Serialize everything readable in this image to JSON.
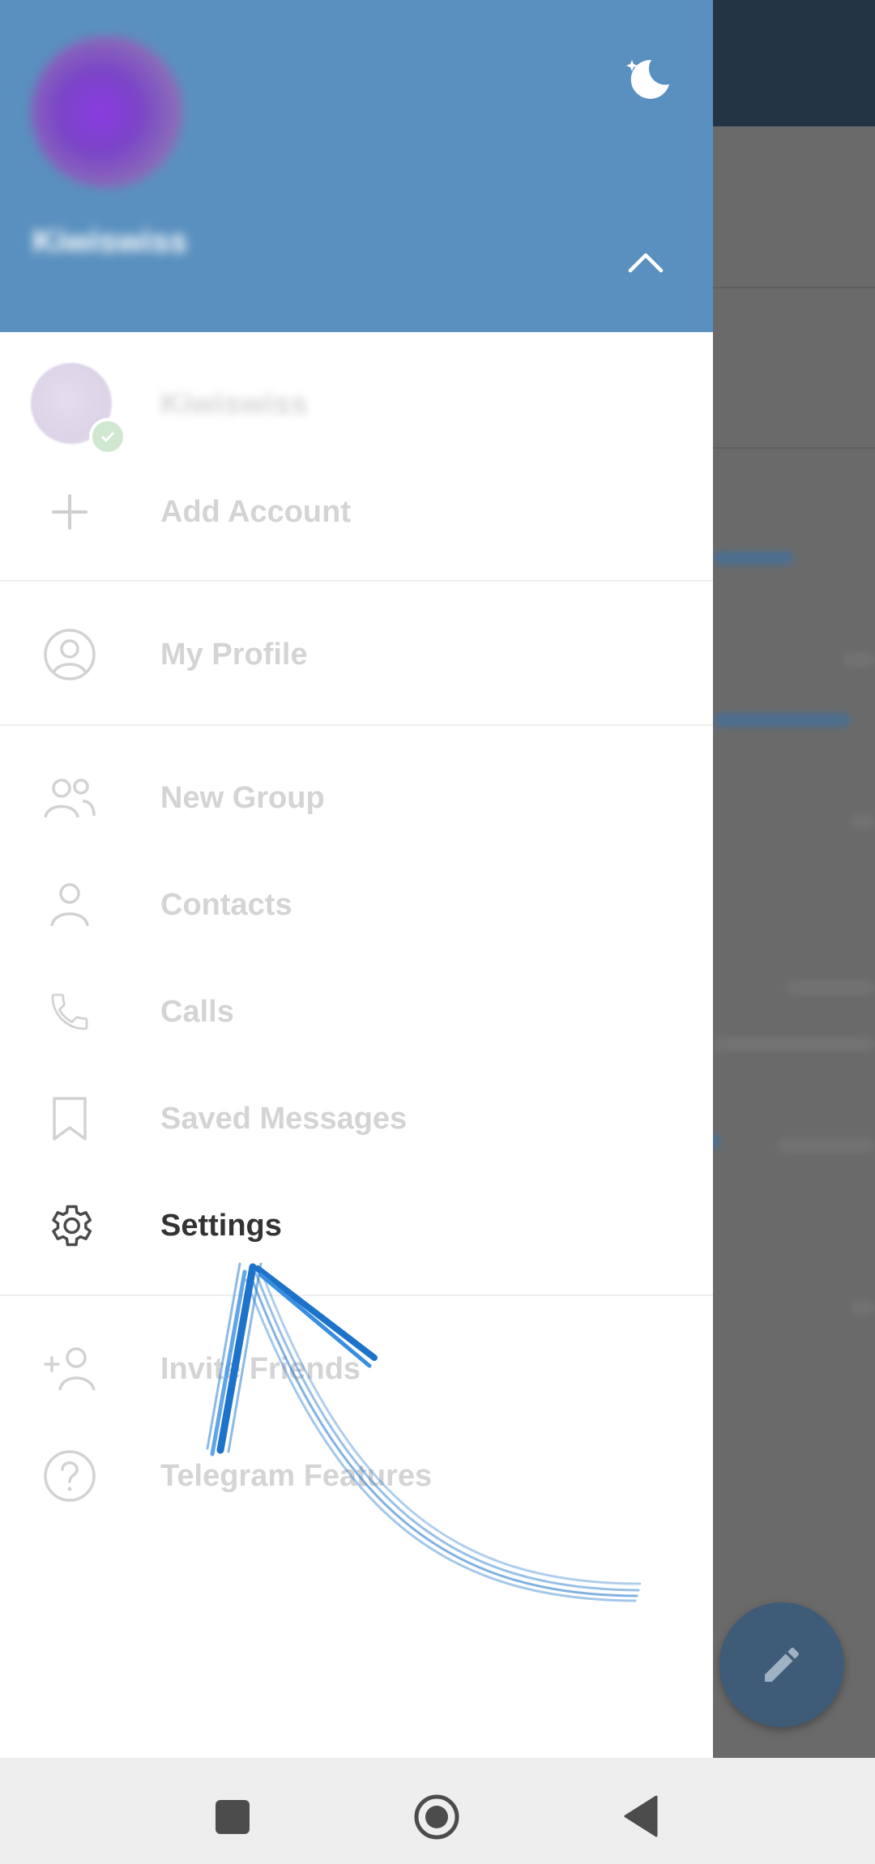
{
  "drawer": {
    "header": {
      "user_name": "Kiwiswiss",
      "night_mode_icon": "moon-stars-icon",
      "toggle_icon": "chevron-up-icon",
      "header_color": "#5a90bf"
    },
    "accounts": {
      "current_account_name": "Kiwiswiss",
      "add_account_label": "Add Account"
    },
    "menu": {
      "my_profile": "My Profile",
      "new_group": "New Group",
      "contacts": "Contacts",
      "calls": "Calls",
      "saved_messages": "Saved Messages",
      "settings": "Settings",
      "invite_friends": "Invite Friends",
      "telegram_features": "Telegram Features"
    }
  },
  "annotation": {
    "arrow_color": "#1c73c9",
    "points_to": "Settings"
  },
  "navbar": {
    "recents_icon": "square-icon",
    "home_icon": "circle-home-icon",
    "back_icon": "triangle-back-icon"
  }
}
